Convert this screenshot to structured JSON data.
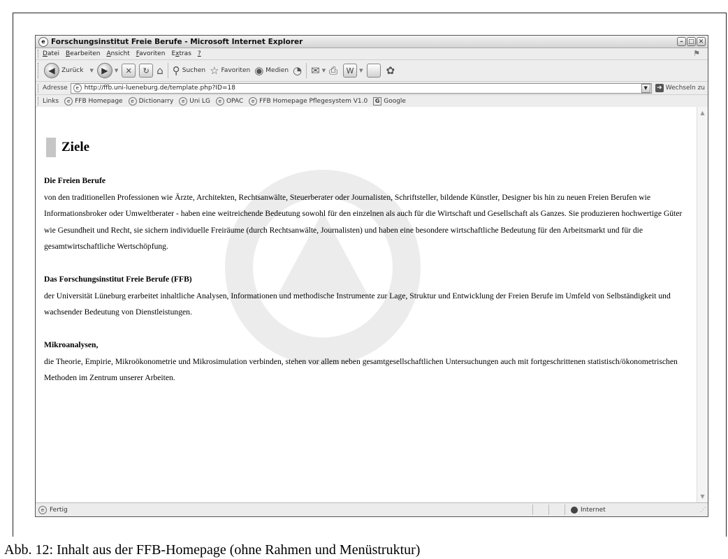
{
  "window": {
    "title": "Forschungsinstitut Freie Berufe - Microsoft Internet Explorer"
  },
  "menu": [
    {
      "pre": "",
      "u": "D",
      "post": "atei"
    },
    {
      "pre": "",
      "u": "B",
      "post": "earbeiten"
    },
    {
      "pre": "",
      "u": "A",
      "post": "nsicht"
    },
    {
      "pre": "",
      "u": "F",
      "post": "avoriten"
    },
    {
      "pre": "E",
      "u": "x",
      "post": "tras"
    },
    {
      "pre": "",
      "u": "?",
      "post": ""
    }
  ],
  "toolbar": {
    "back_label": "Zurück",
    "search_label": "Suchen",
    "favorites_label": "Favoriten",
    "media_label": "Medien"
  },
  "address": {
    "label": "Adresse",
    "url": "http://ffb.uni-lueneburg.de/template.php?ID=18",
    "go_label": "Wechseln zu"
  },
  "links": {
    "label": "Links",
    "items": [
      "FFB Homepage",
      "Dictionarry",
      "Uni LG",
      "OPAC",
      "FFB Homepage Pflegesystem V1.0",
      "Google"
    ]
  },
  "page": {
    "heading": "Ziele",
    "sections": [
      {
        "title": "Die Freien Berufe",
        "body": "von den traditionellen Professionen wie Ärzte, Architekten, Rechtsanwälte, Steuerberater oder Journalisten, Schriftsteller, bildende Künstler, Designer bis hin zu neuen Freien Berufen wie Informationsbroker oder Umweltberater - haben eine weitreichende Bedeutung sowohl für den einzelnen als auch für die Wirtschaft und Gesellschaft als Ganzes. Sie produzieren hochwertige Güter wie Gesundheit und Recht, sie sichern individuelle Freiräume (durch Rechtsanwälte, Journalisten) und haben eine besondere wirtschaftliche Bedeutung für den Arbeitsmarkt und für die gesamtwirtschaftliche Wertschöpfung."
      },
      {
        "title": "Das Forschungsinstitut Freie Berufe (FFB)",
        "body": "der Universität Lüneburg erarbeitet inhaltliche Analysen, Informationen und methodische Instrumente zur Lage, Struktur und Entwicklung der Freien Berufe im Umfeld von Selbständigkeit und wachsender Bedeutung von Dienstleistungen."
      },
      {
        "title": "Mikroanalysen,",
        "body": "die Theorie, Empirie, Mikroökonometrie und Mikrosimulation verbinden, stehen vor allem neben gesamtgesellschaftlichen Untersuchungen auch mit fortgeschrittenen statistisch/ökonometrischen Methoden im Zentrum unserer Arbeiten."
      }
    ]
  },
  "status": {
    "text": "Fertig",
    "zone": "Internet"
  },
  "caption": "Abb. 12: Inhalt aus der FFB-Homepage (ohne Rahmen und Menüstruktur)"
}
